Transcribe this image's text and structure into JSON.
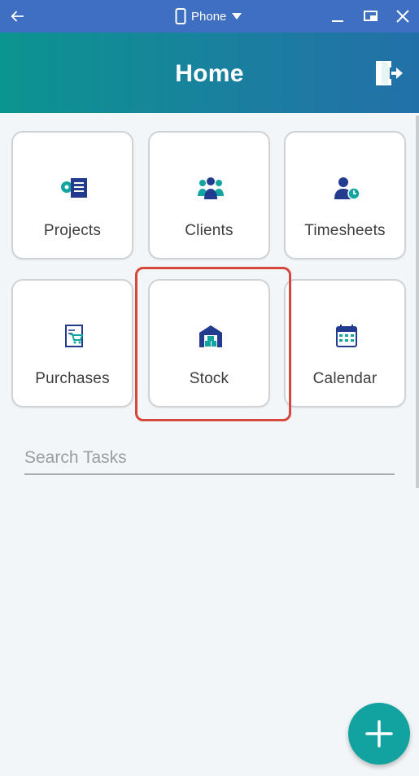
{
  "window": {
    "device_label": "Phone",
    "icons": [
      "back-arrow-icon",
      "phone-icon",
      "dropdown-caret-icon",
      "minimize-icon",
      "restore-icon",
      "close-icon"
    ]
  },
  "header": {
    "title": "Home",
    "logout_icon": "logout-icon"
  },
  "tiles": [
    {
      "label": "Projects",
      "icon": "projects-icon"
    },
    {
      "label": "Clients",
      "icon": "clients-icon"
    },
    {
      "label": "Timesheets",
      "icon": "timesheets-icon"
    },
    {
      "label": "Purchases",
      "icon": "purchases-icon"
    },
    {
      "label": "Stock",
      "icon": "stock-icon"
    },
    {
      "label": "Calendar",
      "icon": "calendar-icon"
    }
  ],
  "search": {
    "placeholder": "Search Tasks",
    "value": ""
  },
  "fab": {
    "icon": "plus-icon"
  },
  "colors": {
    "titlebar": "#3f6fc0",
    "header_gradient_start": "#0b958f",
    "header_gradient_end": "#2270a8",
    "icon_teal": "#11a4a0",
    "icon_navy": "#233b8f",
    "highlight": "#d6483c",
    "fab": "#12a3a0"
  }
}
